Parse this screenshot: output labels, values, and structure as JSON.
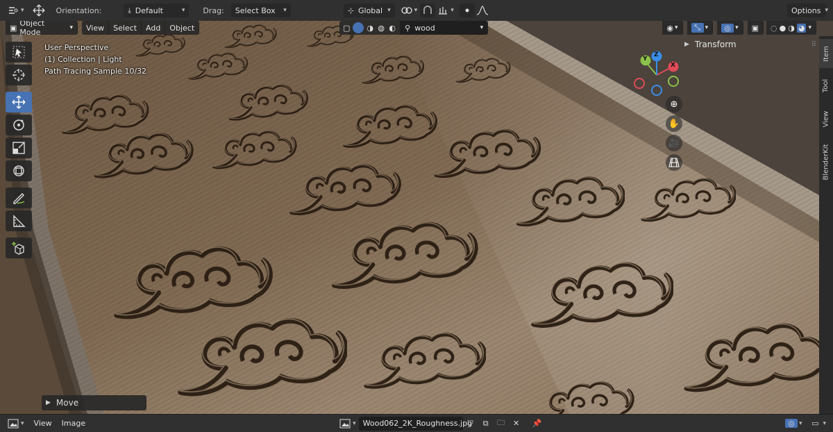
{
  "topbar": {
    "orientation_label": "Orientation:",
    "orientation_value": "Default",
    "drag_label": "Drag:",
    "drag_value": "Select Box",
    "transform_space": "Global",
    "options_label": "Options"
  },
  "view_header": {
    "mode": "Object Mode",
    "menus": [
      "View",
      "Select",
      "Add",
      "Object"
    ],
    "search_value": "wood"
  },
  "overlay": {
    "line1": "User Perspective",
    "line2": "(1) Collection | Light",
    "line3": "Path Tracing Sample 10/32"
  },
  "sidebar": {
    "panel_title": "Transform",
    "tabs": [
      "Item",
      "Tool",
      "View",
      "BlenderKit"
    ]
  },
  "gizmo": {
    "x": "X",
    "y": "Y",
    "z": "Z"
  },
  "redo_panel": {
    "label": "Move"
  },
  "bottombar": {
    "menus": [
      "View",
      "Image"
    ],
    "image_name": "Wood062_2K_Roughness.jpg"
  },
  "colors": {
    "accent": "#4772b3",
    "axis_x": "#e04b58",
    "axis_y": "#8bc34a",
    "axis_z": "#3b8ee8",
    "wood": "#7a6550"
  }
}
